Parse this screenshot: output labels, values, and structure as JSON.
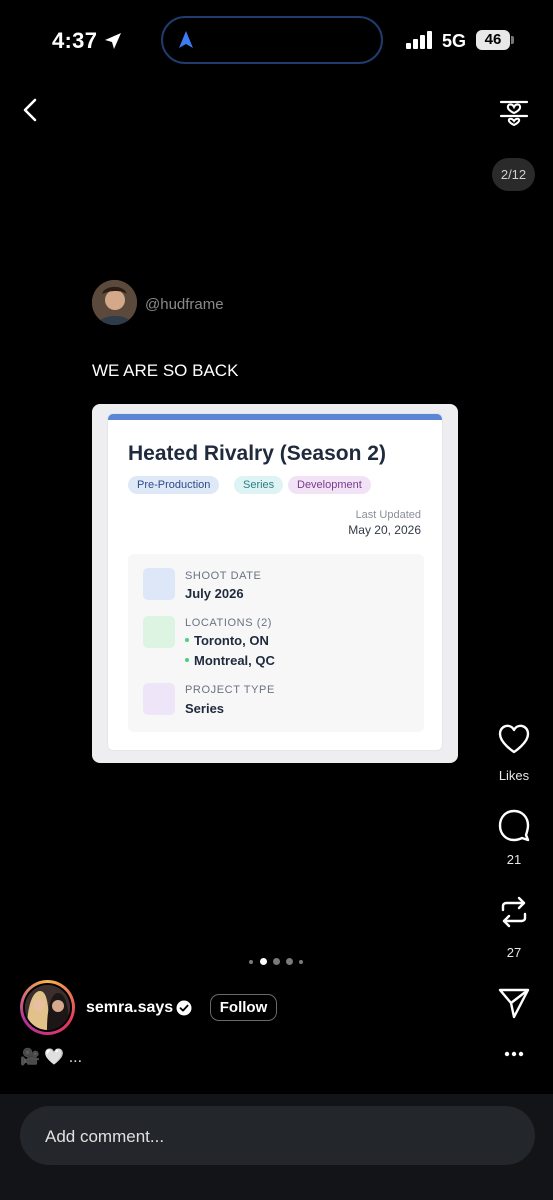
{
  "status_bar": {
    "time": "4:37",
    "network": "5G",
    "battery": "46"
  },
  "viewer": {
    "page_indicator": "2/12"
  },
  "post": {
    "handle": "@hudframe",
    "text": "WE ARE SO BACK",
    "card": {
      "title": "Heated Rivalry (Season 2)",
      "tags": [
        "Pre-Production",
        "Series",
        "Development"
      ],
      "last_updated_label": "Last Updated",
      "last_updated_date": "May 20, 2026",
      "shoot_date_label": "SHOOT DATE",
      "shoot_date_value": "July 2026",
      "locations_label": "LOCATIONS (2)",
      "locations": [
        "Toronto, ON",
        "Montreal, QC"
      ],
      "project_type_label": "PROJECT TYPE",
      "project_type_value": "Series"
    }
  },
  "actions": {
    "likes_label": "Likes",
    "comments_count": "21",
    "reposts_count": "27"
  },
  "carousel": {
    "total": 5,
    "active": 1
  },
  "author": {
    "username": "semra.says",
    "follow_label": "Follow",
    "caption": "🎥 🤍 ..."
  },
  "comment": {
    "placeholder": "Add comment..."
  },
  "colors": {
    "accent_bar": "#5b86d6",
    "island_border": "#1e3c6e"
  },
  "icons": [
    "location-arrow-icon",
    "navigation-icon",
    "signal-icon",
    "back-icon",
    "filter-heart-icon",
    "heart-icon",
    "comment-icon",
    "repost-icon",
    "send-icon",
    "more-icon",
    "verified-icon"
  ]
}
